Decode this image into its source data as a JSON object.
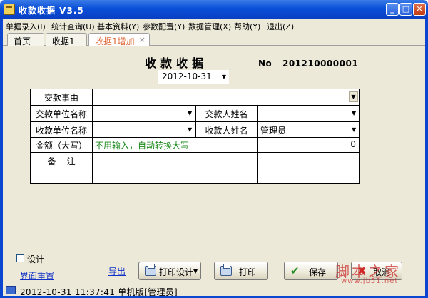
{
  "window": {
    "title": "收款收据 V3.5",
    "btn_min": "_",
    "btn_max": "□",
    "btn_close": "✕"
  },
  "menu": [
    "单据录入(I)",
    "统计查询(U)",
    "基本资料(Y)",
    "参数配置(Y)",
    "数据管理(X)",
    "帮助(Y)",
    "退出(Z)"
  ],
  "tabs": [
    {
      "label": "首页"
    },
    {
      "label": "收据1"
    },
    {
      "label": "收据1增加",
      "active": true,
      "close": "×"
    }
  ],
  "form": {
    "title": "收款收据",
    "no_label": "No",
    "no_value": "201210000001",
    "date": "2012-10-31",
    "rows": {
      "payment_matter_label": "交款事由",
      "payer_unit_label": "交款单位名称",
      "payer_name_label": "交款人姓名",
      "payee_unit_label": "收款单位名称",
      "payee_name_label": "收款人姓名",
      "payee_name_value": "管理员",
      "amount_label": "金额（大写）",
      "amount_hint": "不用输入，自动转换大写",
      "amount_value": "0",
      "remark_label": "备    注"
    }
  },
  "controls": {
    "design_label": "设计",
    "reset_ui_link": "界面重置",
    "export_link": "导出",
    "print_design": "打印设计",
    "print": "打印",
    "save": "保存",
    "cancel": "取消"
  },
  "statusbar": {
    "text": "2012-10-31 11:37:41 单机版[管理员]"
  },
  "watermark": {
    "text": "脚本之家",
    "sub": "www.jb51.net"
  },
  "colors": {
    "titlebar": "#0a4fd8",
    "active_tab": "#e06a3a",
    "hint_green": "#1a8a1a",
    "link_blue": "#1030c8"
  }
}
